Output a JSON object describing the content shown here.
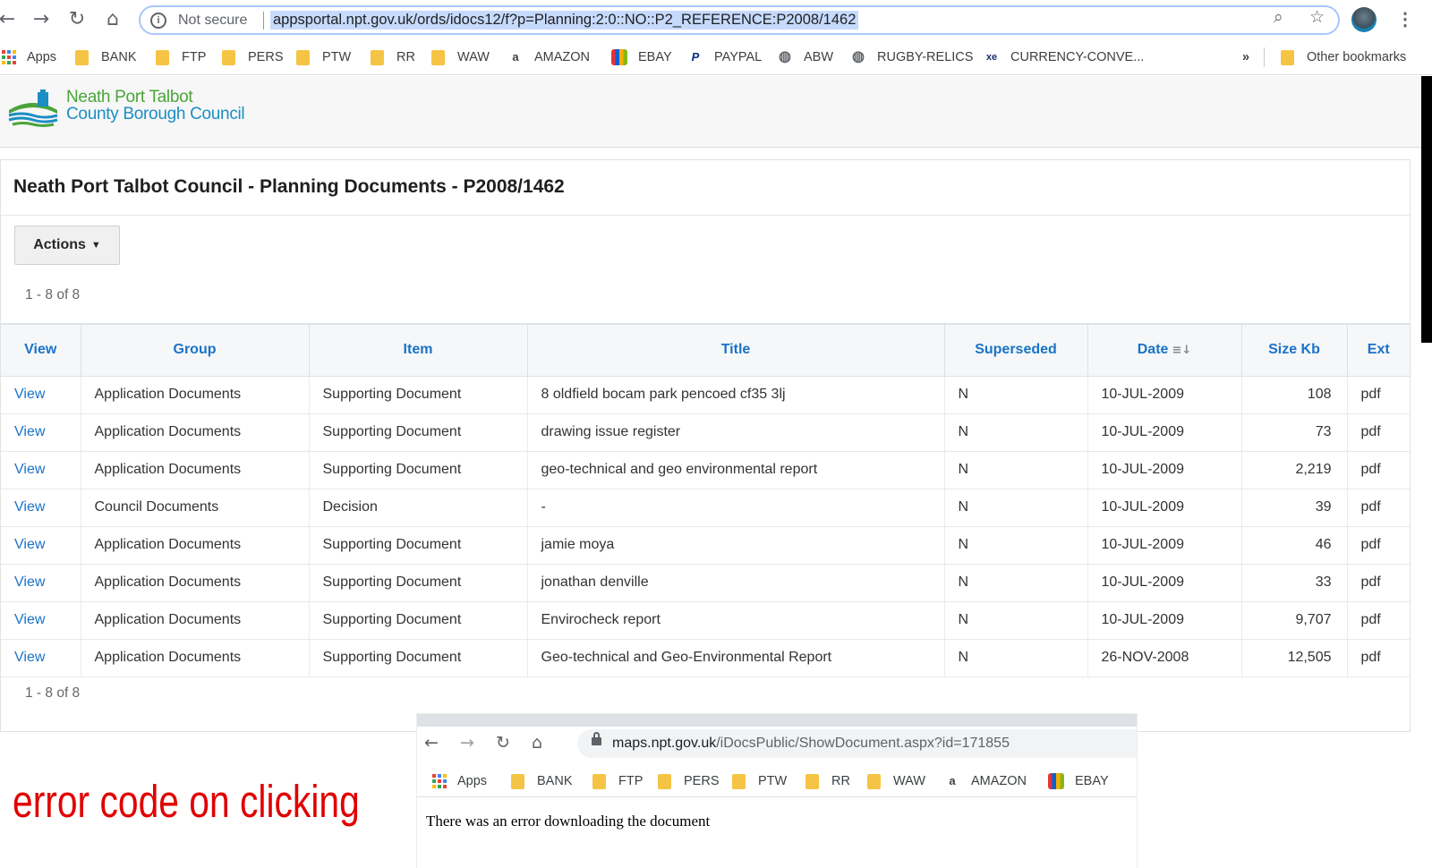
{
  "browser": {
    "security_label": "Not secure",
    "url": "appsportal.npt.gov.uk/ords/idocs12/f?p=Planning:2:0::NO::P2_REFERENCE:P2008/1462",
    "bookmarks": [
      {
        "label": "Apps",
        "icon": "apps-grid-icon"
      },
      {
        "label": "BANK",
        "icon": "folder-icon"
      },
      {
        "label": "FTP",
        "icon": "folder-icon"
      },
      {
        "label": "PERS",
        "icon": "folder-icon"
      },
      {
        "label": "PTW",
        "icon": "folder-icon"
      },
      {
        "label": "RR",
        "icon": "folder-icon"
      },
      {
        "label": "WAW",
        "icon": "folder-icon"
      },
      {
        "label": "AMAZON",
        "icon": "amazon-icon"
      },
      {
        "label": "EBAY",
        "icon": "ebay-icon"
      },
      {
        "label": "PAYPAL",
        "icon": "paypal-icon"
      },
      {
        "label": "ABW",
        "icon": "globe-icon"
      },
      {
        "label": "RUGBY-RELICS",
        "icon": "globe-icon"
      },
      {
        "label": "CURRENCY-CONVE...",
        "icon": "xe-icon"
      }
    ],
    "more_bookmarks": "»",
    "other_bookmarks": "Other bookmarks"
  },
  "site": {
    "logo_line1": "Neath Port Talbot",
    "logo_line2": "County Borough Council"
  },
  "region": {
    "title": "Neath Port Talbot Council - Planning Documents - P2008/1462",
    "actions_label": "Actions",
    "pagination_top": "1 - 8 of 8",
    "pagination_bottom": "1 - 8 of 8"
  },
  "table": {
    "headers": [
      "View",
      "Group",
      "Item",
      "Title",
      "Superseded",
      "Date",
      "Size Kb",
      "Ext"
    ],
    "rows": [
      [
        "View",
        "Application Documents",
        "Supporting Document",
        "8 oldfield bocam park pencoed cf35 3lj",
        "N",
        "10-JUL-2009",
        "108",
        "pdf"
      ],
      [
        "View",
        "Application Documents",
        "Supporting Document",
        "drawing issue register",
        "N",
        "10-JUL-2009",
        "73",
        "pdf"
      ],
      [
        "View",
        "Application Documents",
        "Supporting Document",
        "geo-technical and geo environmental report",
        "N",
        "10-JUL-2009",
        "2,219",
        "pdf"
      ],
      [
        "View",
        "Council Documents",
        "Decision",
        "-",
        "N",
        "10-JUL-2009",
        "39",
        "pdf"
      ],
      [
        "View",
        "Application Documents",
        "Supporting Document",
        "jamie moya",
        "N",
        "10-JUL-2009",
        "46",
        "pdf"
      ],
      [
        "View",
        "Application Documents",
        "Supporting Document",
        "jonathan denville",
        "N",
        "10-JUL-2009",
        "33",
        "pdf"
      ],
      [
        "View",
        "Application Documents",
        "Supporting Document",
        "Envirocheck report",
        "N",
        "10-JUL-2009",
        "9,707",
        "pdf"
      ],
      [
        "View",
        "Application Documents",
        "Supporting Document",
        "Geo-technical and Geo-Environmental Report",
        "N",
        "26-NOV-2008",
        "12,505",
        "pdf"
      ]
    ]
  },
  "annotation": {
    "text": "error code on clicking",
    "color": "#e00000"
  },
  "popup": {
    "url_host": "maps.npt.gov.uk",
    "url_path": "/iDocsPublic/ShowDocument.aspx?id=171855",
    "bookmarks": [
      {
        "label": "Apps",
        "icon": "apps-grid-icon"
      },
      {
        "label": "BANK",
        "icon": "folder-icon"
      },
      {
        "label": "FTP",
        "icon": "folder-icon"
      },
      {
        "label": "PERS",
        "icon": "folder-icon"
      },
      {
        "label": "PTW",
        "icon": "folder-icon"
      },
      {
        "label": "RR",
        "icon": "folder-icon"
      },
      {
        "label": "WAW",
        "icon": "folder-icon"
      },
      {
        "label": "AMAZON",
        "icon": "amazon-icon"
      },
      {
        "label": "EBAY",
        "icon": "ebay-icon"
      }
    ],
    "message": "There was an error downloading the document"
  },
  "colors": {
    "link": "#1a73c8",
    "logo_green": "#4aa43a",
    "logo_blue": "#1b8ec4",
    "folder": "#f6c445"
  }
}
